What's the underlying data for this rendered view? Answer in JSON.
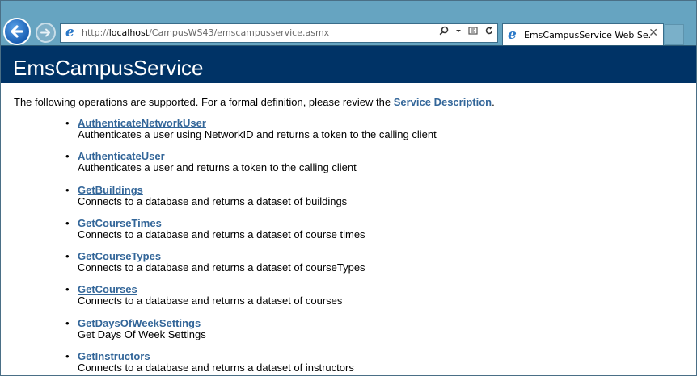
{
  "browser": {
    "url_prefix": "http://",
    "url_host": "localhost",
    "url_path": "/CampusWS43/emscampusservice.asmx",
    "tab_title": "EmsCampusService Web Se...",
    "tab_close": "✕",
    "address_icons": [
      "search-icon",
      "dropdown-icon",
      "compatibility-icon",
      "refresh-icon"
    ]
  },
  "page": {
    "title": "EmsCampusService",
    "intro_text": "The following operations are supported. For a formal definition, please review the ",
    "intro_link": "Service Description",
    "intro_end": ".",
    "operations": [
      {
        "name": "AuthenticateNetworkUser",
        "desc": "Authenticates a user using NetworkID and returns a token to the calling client"
      },
      {
        "name": "AuthenticateUser",
        "desc": "Authenticates a user and returns a token to the calling client"
      },
      {
        "name": "GetBuildings",
        "desc": "Connects to a database and returns a dataset of buildings"
      },
      {
        "name": "GetCourseTimes",
        "desc": "Connects to a database and returns a dataset of course times"
      },
      {
        "name": "GetCourseTypes",
        "desc": "Connects to a database and returns a dataset of courseTypes"
      },
      {
        "name": "GetCourses",
        "desc": "Connects to a database and returns a dataset of courses"
      },
      {
        "name": "GetDaysOfWeekSettings",
        "desc": "Get Days Of Week Settings"
      },
      {
        "name": "GetInstructors",
        "desc": "Connects to a database and returns a dataset of instructors"
      }
    ]
  }
}
